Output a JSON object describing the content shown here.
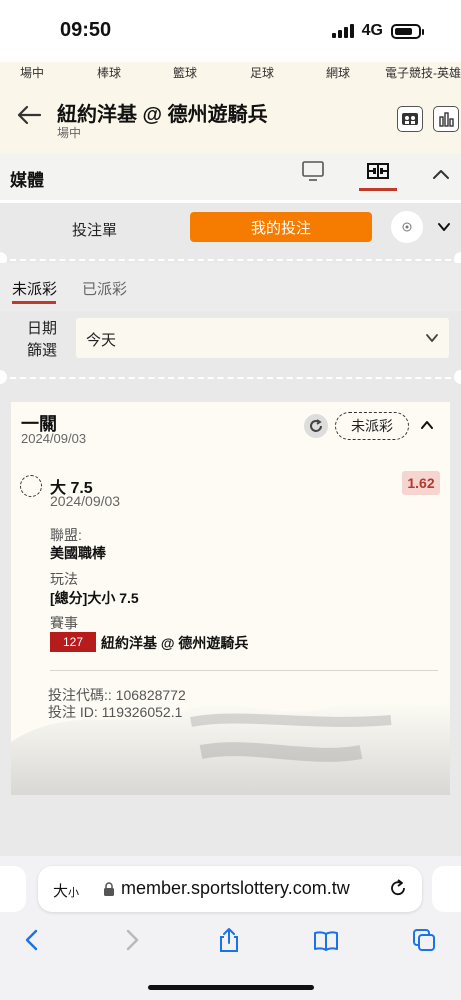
{
  "status_bar": {
    "time": "09:50",
    "network": "4G"
  },
  "sport_tabs": [
    "場中",
    "棒球",
    "籃球",
    "足球",
    "網球",
    "電子競技-英雄"
  ],
  "match": {
    "title": "紐約洋基 @ 德州遊騎兵",
    "subtitle": "場中"
  },
  "media": {
    "label": "媒體"
  },
  "bet_tabs": {
    "slip": "投注單",
    "my_bets": "我的投注"
  },
  "status_tabs": {
    "unsettled": "未派彩",
    "settled": "已派彩"
  },
  "date_filter": {
    "label_line1": "日期",
    "label_line2": "篩選",
    "value": "今天"
  },
  "bet": {
    "type": "一關",
    "date": "2024/09/03",
    "status": "未派彩",
    "selection": "大 7.5",
    "selection_date": "2024/09/03",
    "odds": "1.62",
    "league_label": "聯盟:",
    "league": "美國職棒",
    "market_label": "玩法",
    "market": "[總分]大小 7.5",
    "event_label": "賽事",
    "event_id": "127",
    "event_name": "紐約洋基 @ 德州遊騎兵",
    "code_line": "投注代碼:: 106828772",
    "id_line": "投注 ID: 119326052.1"
  },
  "browser": {
    "aa_big": "大",
    "aa_small": "小",
    "url": "member.sportslottery.com.tw"
  },
  "colors": {
    "accent": "#f57c00",
    "active_underline": "#c0392b",
    "event_badge": "#b71c1c",
    "odds_bg": "#f6d5d0",
    "header_bg": "#fbf6ea"
  }
}
